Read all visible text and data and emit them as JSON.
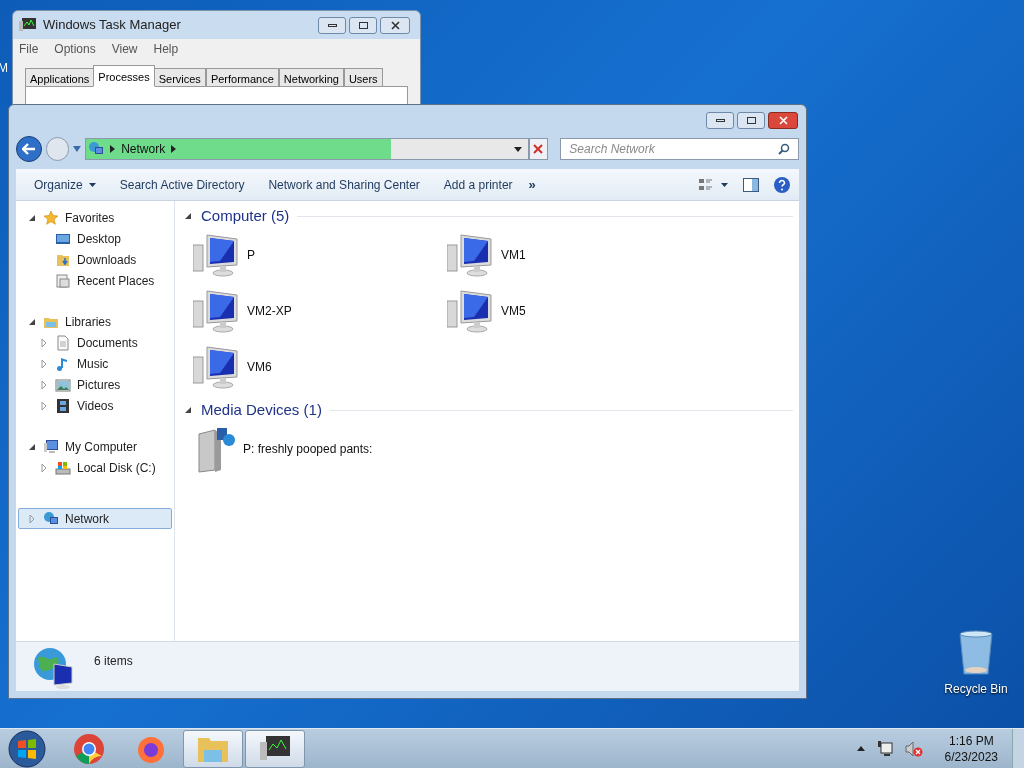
{
  "desktop": {
    "cut_label": "M",
    "icons": [
      {
        "label": "Recycle Bin"
      }
    ]
  },
  "task_manager": {
    "title": "Windows Task Manager",
    "menu": [
      "File",
      "Options",
      "View",
      "Help"
    ],
    "tabs": [
      {
        "label": "Applications",
        "selected": false
      },
      {
        "label": "Processes",
        "selected": true
      },
      {
        "label": "Services",
        "selected": false
      },
      {
        "label": "Performance",
        "selected": false
      },
      {
        "label": "Networking",
        "selected": false
      },
      {
        "label": "Users",
        "selected": false
      }
    ]
  },
  "explorer": {
    "address": {
      "crumbs": [
        "Network"
      ],
      "level": 0.69
    },
    "search": {
      "placeholder": "Search Network"
    },
    "toolbar": [
      {
        "label": "Organize",
        "dropdown": true
      },
      {
        "label": "Search Active Directory",
        "dropdown": false
      },
      {
        "label": "Network and Sharing Center",
        "dropdown": false
      },
      {
        "label": "Add a printer",
        "dropdown": false
      }
    ],
    "toolbar_overflow": "»",
    "nav": [
      {
        "label": "Favorites",
        "kind": "star",
        "expanded": true,
        "selected": false,
        "children": [
          {
            "label": "Desktop",
            "kind": "desktop",
            "selected": false
          },
          {
            "label": "Downloads",
            "kind": "downloads",
            "selected": false
          },
          {
            "label": "Recent Places",
            "kind": "recent",
            "selected": false
          }
        ]
      },
      {
        "label": "Libraries",
        "kind": "libraries",
        "expanded": true,
        "selected": false,
        "children": [
          {
            "label": "Documents",
            "kind": "documents",
            "expanded": false,
            "selected": false
          },
          {
            "label": "Music",
            "kind": "music",
            "expanded": false,
            "selected": false
          },
          {
            "label": "Pictures",
            "kind": "pictures",
            "expanded": false,
            "selected": false
          },
          {
            "label": "Videos",
            "kind": "videos",
            "expanded": false,
            "selected": false
          }
        ]
      },
      {
        "label": "My Computer",
        "kind": "mycomputer",
        "expanded": true,
        "selected": false,
        "children": [
          {
            "label": "Local Disk (C:)",
            "kind": "disk",
            "expanded": false,
            "selected": false
          }
        ]
      },
      {
        "label": "Network",
        "kind": "network",
        "expanded": false,
        "selected": true
      }
    ],
    "sections": [
      {
        "title": "Computer (5)",
        "expanded": true,
        "items": [
          {
            "label": "P",
            "kind": "computer"
          },
          {
            "label": "VM1",
            "kind": "computer"
          },
          {
            "label": "VM2-XP",
            "kind": "computer"
          },
          {
            "label": "VM5",
            "kind": "computer"
          },
          {
            "label": "VM6",
            "kind": "computer"
          }
        ]
      },
      {
        "title": "Media Devices (1)",
        "expanded": true,
        "items": [
          {
            "label": "P: freshly pooped pants:",
            "kind": "media"
          }
        ]
      }
    ],
    "status": "6 items"
  },
  "taskbar": {
    "apps": [
      {
        "kind": "chrome",
        "open": false
      },
      {
        "kind": "firefox",
        "open": false
      },
      {
        "kind": "explorer",
        "open": true
      },
      {
        "kind": "taskmgr",
        "open": true
      }
    ],
    "clock": {
      "time": "1:16 PM",
      "date": "6/23/2023"
    }
  }
}
